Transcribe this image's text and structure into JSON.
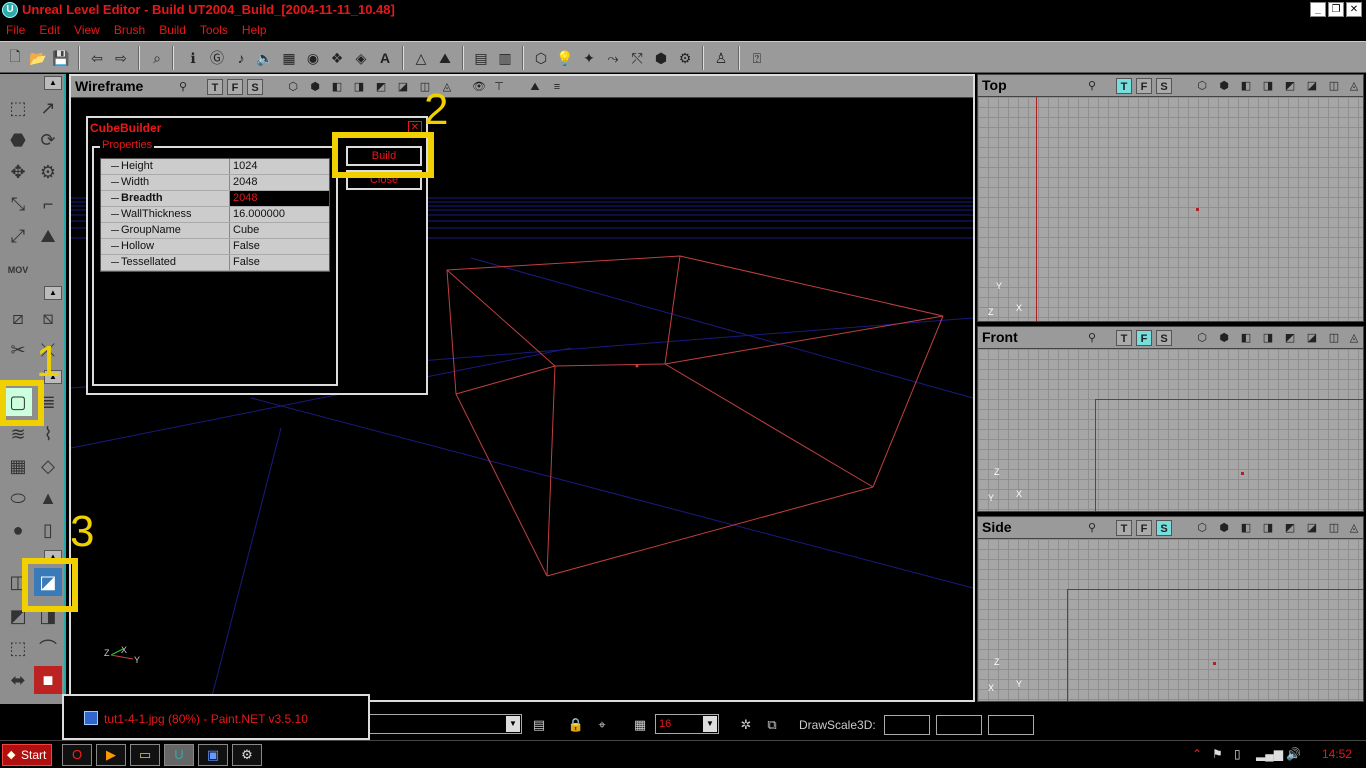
{
  "window": {
    "title": "Unreal Level Editor - Build UT2004_Build_[2004-11-11_10.48]",
    "app_icon_glyph": "U"
  },
  "menu": [
    "File",
    "Edit",
    "View",
    "Brush",
    "Build",
    "Tools",
    "Help"
  ],
  "main_viewport": {
    "title": "Wireframe",
    "tfs": [
      "T",
      "F",
      "S"
    ]
  },
  "cube_builder": {
    "title": "CubeBuilder",
    "group_label": "Properties",
    "properties": [
      {
        "key": "Height",
        "value": "1024"
      },
      {
        "key": "Width",
        "value": "2048"
      },
      {
        "key": "Breadth",
        "value": "2048"
      },
      {
        "key": "WallThickness",
        "value": "16.000000"
      },
      {
        "key": "GroupName",
        "value": "Cube"
      },
      {
        "key": "Hollow",
        "value": "False"
      },
      {
        "key": "Tessellated",
        "value": "False"
      }
    ],
    "selected_property": "Breadth",
    "build_label": "Build",
    "close_label": "Close"
  },
  "annotations": {
    "one": "1",
    "two": "2",
    "three": "3",
    "color": "#f0d000"
  },
  "side_viewports": [
    {
      "title": "Top",
      "active": "T",
      "axes": [
        "Y",
        "Z",
        "X"
      ]
    },
    {
      "title": "Front",
      "active": "F",
      "axes": [
        "Z",
        "Y",
        "X"
      ]
    },
    {
      "title": "Side",
      "active": "S",
      "axes": [
        "Z",
        "X",
        "Y"
      ]
    }
  ],
  "status": {
    "grid_value": "16",
    "drawscale_label": "DrawScale3D:"
  },
  "tooltip": {
    "text": "tut1-4-1.jpg (80%) - Paint.NET v3.5.10"
  },
  "taskbar": {
    "start_label": "Start",
    "clock": "14:52"
  },
  "colors": {
    "accent_red": "#e81818",
    "panel_gray": "#9a9a9a",
    "highlight_yellow": "#f0d000",
    "wire_red": "#c04040",
    "wire_blue": "#1a1a80"
  }
}
